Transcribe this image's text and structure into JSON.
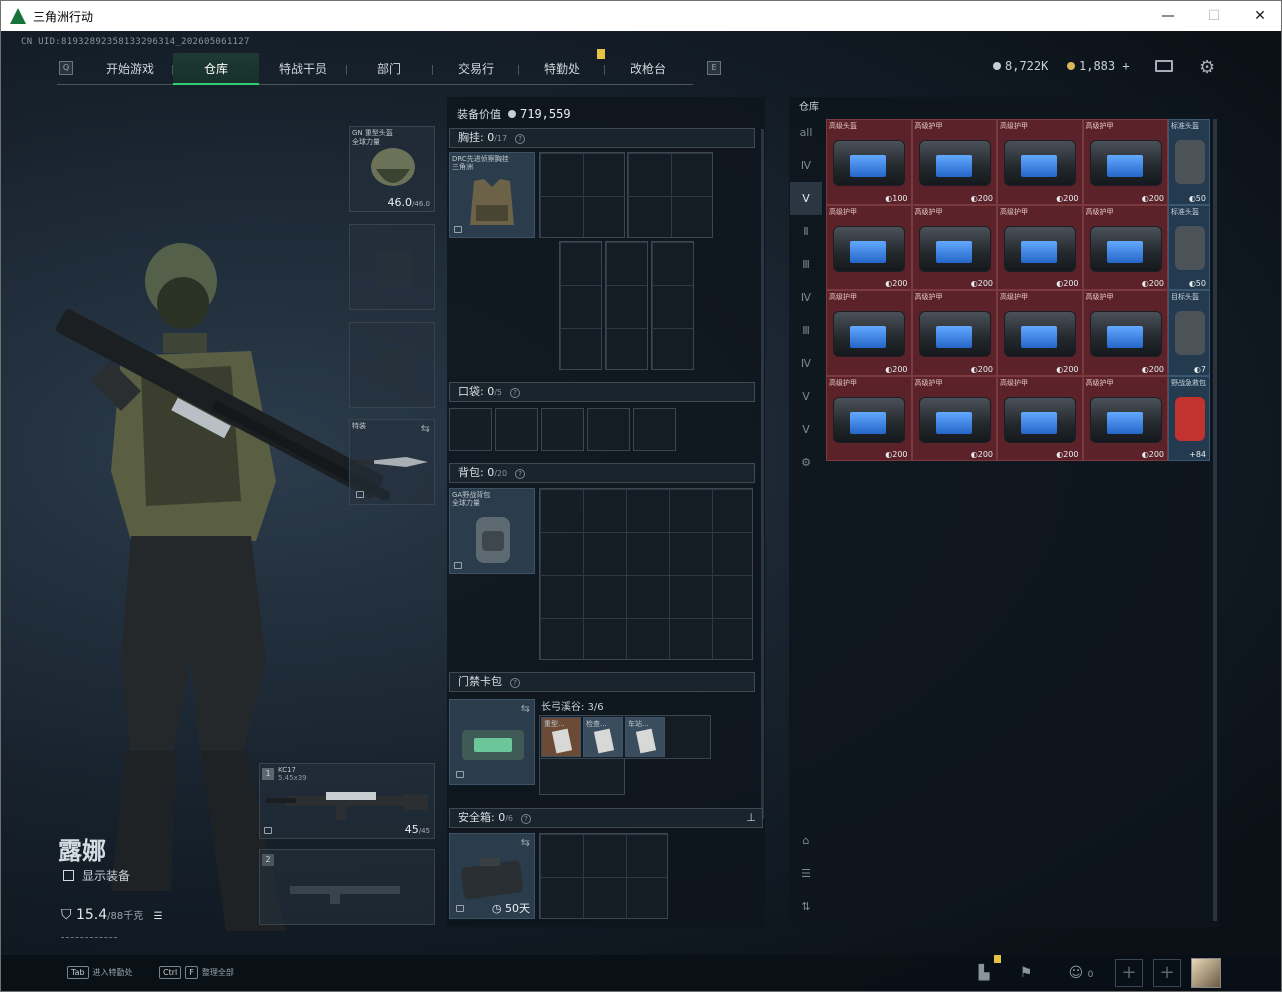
{
  "window": {
    "title": "三角洲行动",
    "min": "—",
    "max": "☐",
    "close": "✕"
  },
  "uid": "CN UID:8193289235813329631​4_202605061127",
  "nav": {
    "tabs": [
      "开始游戏",
      "仓库",
      "特战干员",
      "部门",
      "交易行",
      "特勤处",
      "改枪台"
    ],
    "active": "仓库",
    "left_key": "Q",
    "right_key": "E"
  },
  "currency": {
    "silver": "8,722K",
    "gold": "1,883",
    "plus": "+"
  },
  "character": {
    "name": "露娜",
    "show_equipment": "显示装备",
    "weight": "15.4",
    "weight_max": "/88千克"
  },
  "equipment": {
    "helmet": {
      "label": "GN 重型头盔\n全球力量",
      "durability": "46.0",
      "durability_max": "/46.0"
    },
    "melee": {
      "label": "特装"
    },
    "primary": {
      "slot": "1",
      "name": "KC17",
      "ammo_type": "5.45x39",
      "ammo": "45",
      "ammo_max": "/45"
    },
    "secondary": {
      "slot": "2"
    }
  },
  "gear": {
    "value_label": "装备价值",
    "value": "719,559",
    "chest": {
      "title": "胸挂:",
      "count": "0",
      "max": "/17",
      "item": "DRC先进侦察胸挂\n三角洲"
    },
    "pocket": {
      "title": "口袋:",
      "count": "0",
      "max": "/5"
    },
    "backpack": {
      "title": "背包:",
      "count": "0",
      "max": "/20",
      "item": "GA野战背包\n全球力量"
    },
    "keycard": {
      "title": "门禁卡包",
      "map": "长弓溪谷: 3/6",
      "cards": [
        "重型...",
        "检查...",
        "车站..."
      ]
    },
    "safe": {
      "title": "安全箱:",
      "count": "0",
      "max": "/6",
      "time": "50天"
    }
  },
  "storage": {
    "title": "仓库",
    "side_tabs": [
      "all",
      "Ⅳ",
      "Ⅴ",
      "Ⅱ",
      "Ⅲ",
      "Ⅳ",
      "Ⅲ",
      "Ⅳ",
      "Ⅴ",
      "Ⅴ",
      "⚙"
    ],
    "rows": [
      {
        "labels": [
          "高级头盔",
          "高级护甲",
          "高级护甲",
          "高级护甲"
        ],
        "caps": [
          "100",
          "200",
          "200",
          "200"
        ],
        "side": {
          "label": "标准头盔",
          "cap": "50"
        }
      },
      {
        "labels": [
          "高级护甲",
          "高级护甲",
          "高级护甲",
          "高级护甲"
        ],
        "caps": [
          "200",
          "200",
          "200",
          "200"
        ],
        "side": {
          "label": "标准头盔",
          "cap": "50"
        }
      },
      {
        "labels": [
          "高级护甲",
          "高级护甲",
          "高级护甲",
          "高级护甲"
        ],
        "caps": [
          "200",
          "200",
          "200",
          "200"
        ],
        "side": {
          "label": "目标头盔",
          "cap": "7"
        }
      },
      {
        "labels": [
          "高级护甲",
          "高级护甲",
          "高级护甲",
          "高级护甲"
        ],
        "caps": [
          "200",
          "200",
          "200",
          "200"
        ],
        "side": {
          "label": "野战急救包",
          "cap": "84"
        }
      }
    ]
  },
  "bottom": {
    "hint1_key": "Tab",
    "hint1": "进入特勤处",
    "hint2_key1": "Ctrl",
    "hint2_key2": "F",
    "hint2": "整理全部",
    "squad_count": "0"
  }
}
